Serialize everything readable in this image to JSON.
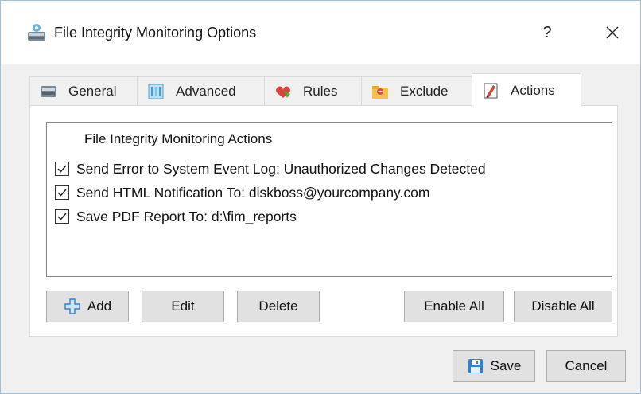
{
  "window": {
    "title": "File Integrity Monitoring Options",
    "help_label": "?"
  },
  "tabs": [
    {
      "label": "General",
      "icon": "general-icon",
      "active": false
    },
    {
      "label": "Advanced",
      "icon": "advanced-icon",
      "active": false
    },
    {
      "label": "Rules",
      "icon": "rules-icon",
      "active": false
    },
    {
      "label": "Exclude",
      "icon": "exclude-icon",
      "active": false
    },
    {
      "label": "Actions",
      "icon": "actions-icon",
      "active": true
    }
  ],
  "actions_list": {
    "header": "File Integrity Monitoring Actions",
    "items": [
      {
        "label": "Send Error to System Event Log: Unauthorized Changes Detected",
        "checked": true
      },
      {
        "label": "Send HTML Notification To: diskboss@yourcompany.com",
        "checked": true
      },
      {
        "label": "Save PDF Report To: d:\\fim_reports",
        "checked": true
      }
    ]
  },
  "panel_buttons": {
    "add": "Add",
    "edit": "Edit",
    "delete": "Delete",
    "enable_all": "Enable All",
    "disable_all": "Disable All"
  },
  "footer_buttons": {
    "save": "Save",
    "cancel": "Cancel"
  },
  "colors": {
    "window_bg": "#f0f0f0",
    "panel_bg": "#ffffff",
    "button_bg": "#e1e1e1",
    "button_border": "#adadad",
    "accent_blue": "#2f7fd6"
  }
}
